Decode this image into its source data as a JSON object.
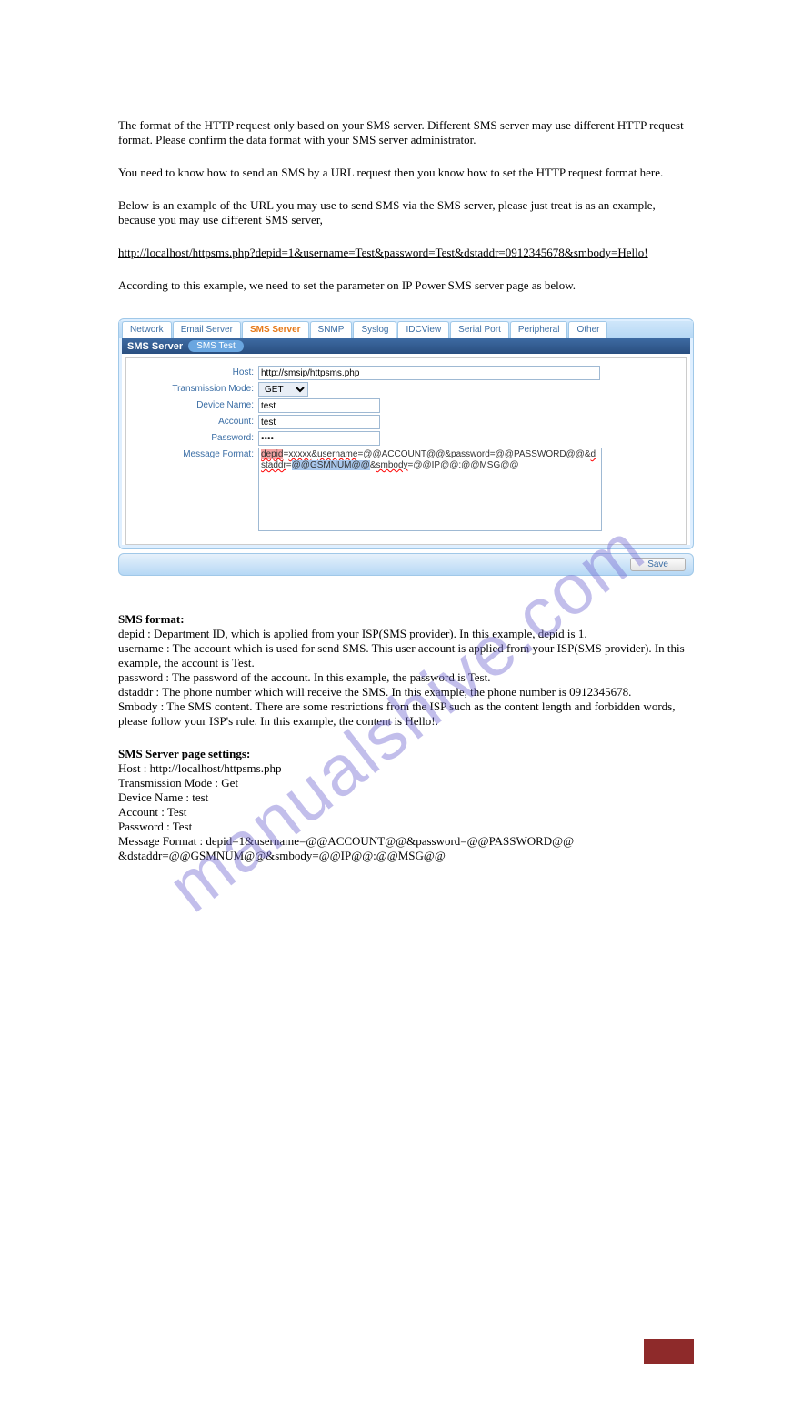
{
  "watermark": "manualshive.com",
  "doc": {
    "para1": "The format of the HTTP request only based on your SMS server. Different SMS server may use different HTTP request format. Please confirm the data format with your SMS server administrator.",
    "para2": "You need to know how to send an SMS by a URL request then you know how to set the HTTP request format here.",
    "para3": "Below is an example of the URL you may use to send SMS via the SMS server, please just treat is as an example, because you may use different SMS server,",
    "url_example": "http://localhost/httpsms.php?depid=1&username=Test&password=Test&dstaddr=0912345678&smbody=Hello!",
    "para4": "According to this example, we need to set the parameter on IP Power SMS server page as below.",
    "below": {
      "hdr1": "SMS format:",
      "body1": "depid            : Department ID, which is applied from your ISP(SMS provider). In this example, depid is 1.",
      "body2": "username    : The account which is used for send SMS. This user account is applied from your ISP(SMS provider). In this example, the account is Test.",
      "body3": "password    : The password of the account. In this example, the password is Test.",
      "body4": "dstaddr         : The phone number which will receive the SMS. In this example, the phone number is 0912345678.",
      "body5": "Smbody        : The SMS content. There are some restrictions from the ISP such as the content length and forbidden words, please follow your ISP's rule. In this example, the content is Hello!.",
      "hdr2": "SMS Server page settings:",
      "set1": "Host                            : http://localhost/httpsms.php",
      "set2": "Transmission Mode : Get",
      "set3": "Device Name              : test",
      "set4": "Account                      : Test",
      "set5": "Password                   : Test",
      "set6": "Message Format     : depid=1&username=@@ACCOUNT@@&password=@@PASSWORD@@ &dstaddr=@@GSMNUM@@&smbody=@@IP@@:@@MSG@@"
    }
  },
  "ui": {
    "tabs": [
      "Network",
      "Email Server",
      "SMS Server",
      "SNMP",
      "Syslog",
      "IDCView",
      "Serial Port",
      "Peripheral",
      "Other"
    ],
    "active_tab_index": 2,
    "section_title": "SMS Server",
    "pill": "SMS Test",
    "labels": {
      "host": "Host:",
      "mode": "Transmission Mode:",
      "device": "Device Name:",
      "account": "Account:",
      "password": "Password:",
      "msgfmt": "Message Format:"
    },
    "values": {
      "host": "http://smsip/httpsms.php",
      "mode": "GET",
      "device": "test",
      "account": "test",
      "password": "••••",
      "msgfmt_raw": "depid=xxxxx&username=@@ACCOUNT@@&password=@@PASSWORD@@&dstaddr=@@GSMNUM@@&smbody=@@IP@@:@@MSG@@"
    },
    "save": "Save"
  }
}
